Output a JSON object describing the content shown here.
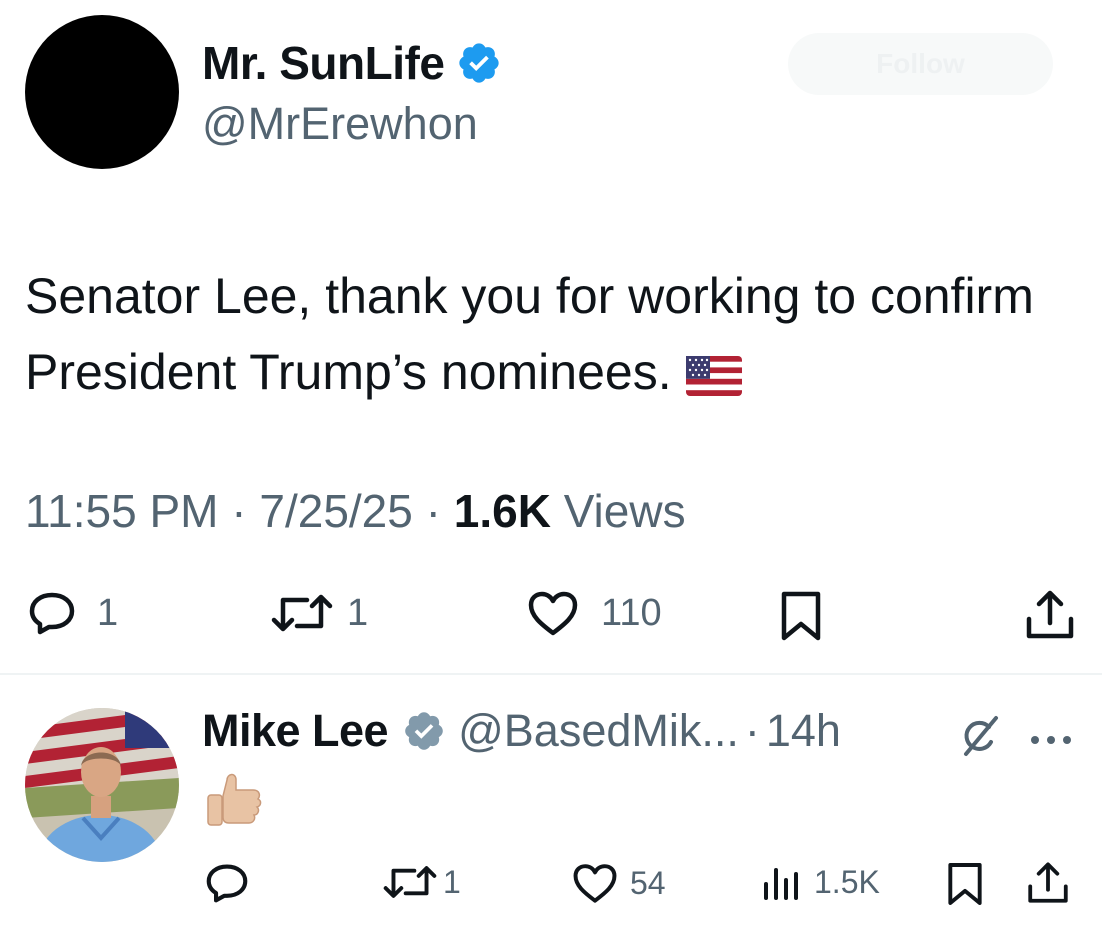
{
  "tweet": {
    "author": {
      "display_name": "Mr. SunLife",
      "handle": "@MrErewhon",
      "verified": true
    },
    "follow_label": "Follow",
    "text": "Senator Lee, thank you for working to confirm President Trump’s nominees.",
    "flag_emoji": "us-flag-emoji",
    "time": "11:55 PM",
    "date": "7/25/25",
    "views_count": "1.6K",
    "views_label": "Views",
    "separator": "·",
    "stats": {
      "replies": "1",
      "retweets": "1",
      "likes": "110"
    }
  },
  "reply": {
    "author": {
      "display_name": "Mike Lee",
      "handle": "@BasedMik...",
      "verified_badge": "gray-verified-badge"
    },
    "separator": "·",
    "time": "14h",
    "content_emoji": "thumbs-up-emoji",
    "stats": {
      "replies": "",
      "retweets": "1",
      "likes": "54",
      "views": "1.5K"
    }
  },
  "colors": {
    "text_primary": "#0f1419",
    "text_secondary": "#536471",
    "verified_blue": "#1d9bf0",
    "verified_gray": "#829aab",
    "divider": "#eff3f4"
  }
}
